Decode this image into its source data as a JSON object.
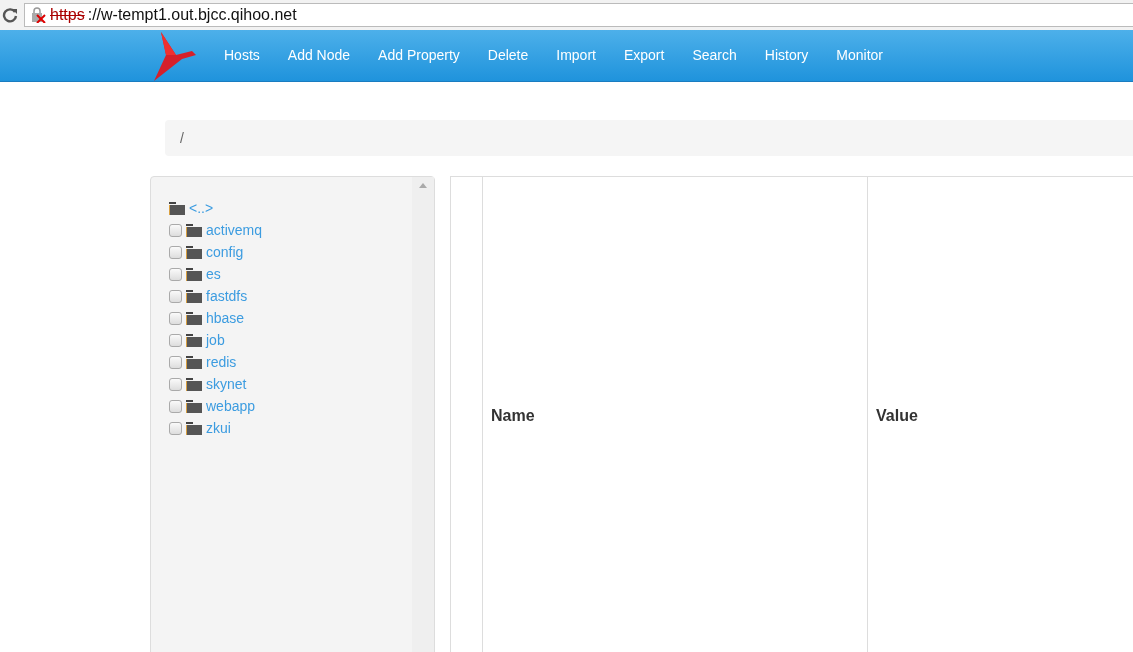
{
  "address_bar": {
    "scheme": "https",
    "rest": "://w-tempt1.out.bjcc.qihoo.net",
    "insecure": true
  },
  "nav": {
    "items": [
      {
        "label": "Hosts"
      },
      {
        "label": "Add Node"
      },
      {
        "label": "Add Property"
      },
      {
        "label": "Delete"
      },
      {
        "label": "Import"
      },
      {
        "label": "Export"
      },
      {
        "label": "Search"
      },
      {
        "label": "History"
      },
      {
        "label": "Monitor"
      }
    ]
  },
  "breadcrumb": "/",
  "tree": {
    "parent": "<..>",
    "items": [
      {
        "label": "activemq",
        "checked": false
      },
      {
        "label": "config",
        "checked": false
      },
      {
        "label": "es",
        "checked": false
      },
      {
        "label": "fastdfs",
        "checked": false
      },
      {
        "label": "hbase",
        "checked": false
      },
      {
        "label": "job",
        "checked": false
      },
      {
        "label": "redis",
        "checked": false
      },
      {
        "label": "skynet",
        "checked": false
      },
      {
        "label": "webapp",
        "checked": false
      },
      {
        "label": "zkui",
        "checked": false
      }
    ]
  },
  "table": {
    "columns": [
      "Name",
      "Value"
    ]
  }
}
